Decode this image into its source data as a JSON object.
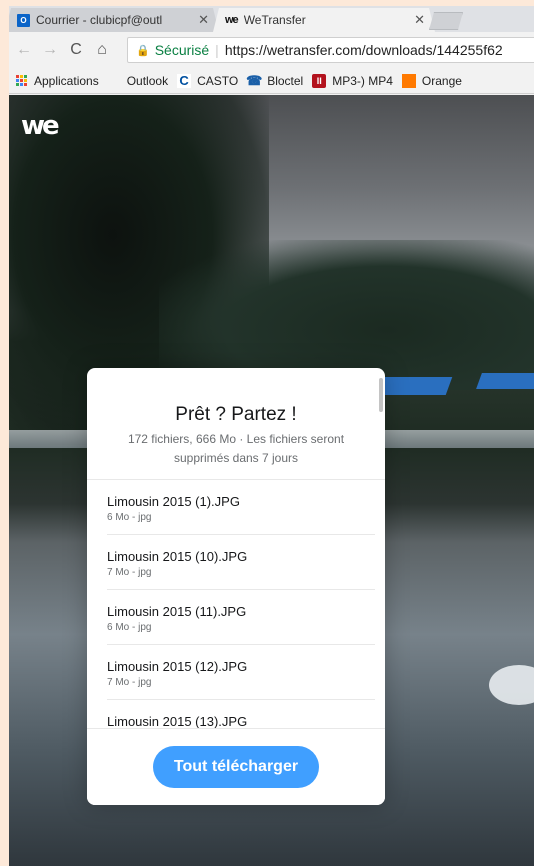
{
  "tabs": [
    {
      "title": "Courrier - clubicpf@outl",
      "icon": "outlook-icon",
      "icon_text": "O",
      "active": false
    },
    {
      "title": "WeTransfer",
      "icon": "wetransfer-icon",
      "icon_text": "we",
      "active": true
    }
  ],
  "toolbar": {
    "secure_label": "Sécurisé",
    "url": "https://wetransfer.com/downloads/144255f62"
  },
  "bookmarks": [
    {
      "label": "Applications",
      "icon": "apps-grid-icon"
    },
    {
      "label": "Outlook",
      "icon": "windows-icon"
    },
    {
      "label": "CASTO",
      "icon": "casto-icon",
      "icon_text": "C"
    },
    {
      "label": "Bloctel",
      "icon": "phone-icon",
      "icon_text": "☎"
    },
    {
      "label": "MP3-) MP4",
      "icon": "mp3-icon",
      "icon_text": "II"
    },
    {
      "label": "Orange",
      "icon": "orange-icon"
    }
  ],
  "page": {
    "logo": "we",
    "panel": {
      "title": "Prêt ? Partez !",
      "subtitle": "172 fichiers, 666 Mo · Les fichiers seront supprimés dans 7 jours",
      "files": [
        {
          "name": "Limousin 2015 (1).JPG",
          "meta": "6 Mo - jpg"
        },
        {
          "name": "Limousin 2015 (10).JPG",
          "meta": "7 Mo - jpg"
        },
        {
          "name": "Limousin 2015 (11).JPG",
          "meta": "6 Mo - jpg"
        },
        {
          "name": "Limousin 2015 (12).JPG",
          "meta": "7 Mo - jpg"
        },
        {
          "name": "Limousin 2015 (13).JPG",
          "meta": ""
        }
      ],
      "download_label": "Tout télécharger"
    }
  },
  "colors": {
    "accent": "#409fff",
    "secure": "#0b8043"
  }
}
